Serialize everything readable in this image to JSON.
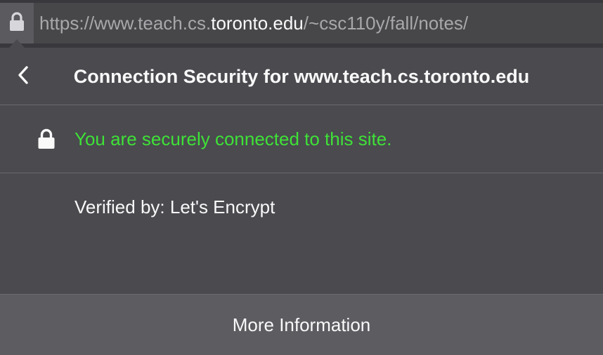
{
  "urlbar": {
    "lock_icon": "padlock-icon",
    "url_scheme_prefix": "https://www.teach.cs.",
    "url_host": "toronto.edu",
    "url_path": "/~csc110y/fall/notes/"
  },
  "panel": {
    "back_icon": "chevron-left-icon",
    "title": "Connection Security for www.teach.cs.toronto.edu",
    "secure_icon": "padlock-icon",
    "secure_message": "You are securely connected to this site.",
    "verified_by": "Verified by: Let's Encrypt",
    "more_info_label": "More Information"
  },
  "colors": {
    "background": "#4a4a4f",
    "secure_green": "#3fe137",
    "text": "#f9f9fa"
  }
}
